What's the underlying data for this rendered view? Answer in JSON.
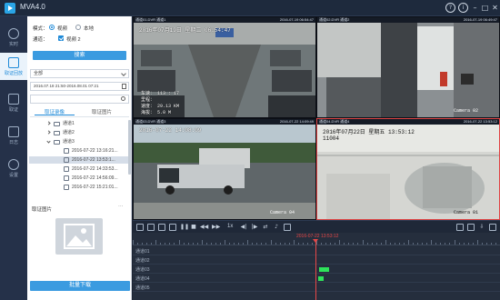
{
  "app": {
    "title": "MVA4.0"
  },
  "titlebar": {
    "help": "?",
    "info": "i",
    "minimize": "–",
    "maximize": "□",
    "close": "✕"
  },
  "nav": [
    {
      "label": "实时",
      "icon": "refresh-icon"
    },
    {
      "label": "取证回放",
      "icon": "playback-icon"
    },
    {
      "label": "取证",
      "icon": "evidence-icon"
    },
    {
      "label": "日志",
      "icon": "log-icon"
    },
    {
      "label": "设置",
      "icon": "settings-icon"
    }
  ],
  "panel": {
    "mode_label": "模式：",
    "mode_video": "视频",
    "mode_local": "本地",
    "channel_label": "通道：",
    "channel_check": "视频 2",
    "search_button": "搜索",
    "select_value": "全部",
    "date_range": "2016.07.18 21:50-2016.08.01 07:21",
    "search_placeholder": "",
    "tabs": [
      "取证录像",
      "取证图片"
    ],
    "tree": [
      {
        "type": "folder",
        "label": "通道1",
        "level": 0,
        "expanded": false
      },
      {
        "type": "folder",
        "label": "通道2",
        "level": 0,
        "expanded": false
      },
      {
        "type": "folder",
        "label": "通道3",
        "level": 0,
        "expanded": true
      },
      {
        "type": "file",
        "label": "2016-07-22  13:16:21...",
        "level": 1,
        "selected": false
      },
      {
        "type": "file",
        "label": "2016-07-22  13:53:1...",
        "level": 1,
        "selected": true
      },
      {
        "type": "file",
        "label": "2016-07-22  14:33:53...",
        "level": 1,
        "selected": false
      },
      {
        "type": "file",
        "label": "2016-07-22  14:56:09...",
        "level": 1,
        "selected": false
      },
      {
        "type": "file",
        "label": "2016-07-22  15:21:01...",
        "level": 1,
        "selected": false
      }
    ],
    "image_section": "取证图片",
    "more": "···",
    "download_button": "批量下载"
  },
  "videos": [
    {
      "label": "通道01.DVR 通道1",
      "time": "2016-07-19 06:54:47",
      "osd_top": "2016年07月19日  星期二  06:54:47",
      "osd_lines": [
        "车速：  113  :  17",
        "里程：",
        "速度：  29.13 KM",
        "海拔：  5.0 M"
      ],
      "camera": ""
    },
    {
      "label": "通道02.DVR 通道2",
      "time": "2016-07-19 06:49:47",
      "osd_top": "",
      "osd_lines": [],
      "camera": "Camera 02"
    },
    {
      "label": "通道03.DVR 通道3",
      "time": "2016-07-22 14:09:49",
      "osd_top": "2016-07-22  14:08:09",
      "osd_lines": [],
      "camera": "Camera 04"
    },
    {
      "label": "通道04.DVR 通道4",
      "time": "2016-07-22 13:53:12",
      "osd_top": "2016年07月22日  星期五  13:53:12",
      "osd_sub": "11004",
      "osd_lines": [],
      "camera": "Camera 01"
    }
  ],
  "playback": {
    "speed": "1x"
  },
  "timeline": {
    "current_time": "2016-07-22 13:53:12",
    "channels": [
      "通道01",
      "通道02",
      "通道03",
      "通道04",
      "通道05"
    ],
    "recordings": [
      {
        "channel": 2,
        "start": 0.508,
        "end": 0.535
      },
      {
        "channel": 3,
        "start": 0.505,
        "end": 0.52
      }
    ]
  },
  "colors": {
    "accent": "#1f8ad8",
    "record": "#2ee35a",
    "cursor": "#e84747"
  }
}
